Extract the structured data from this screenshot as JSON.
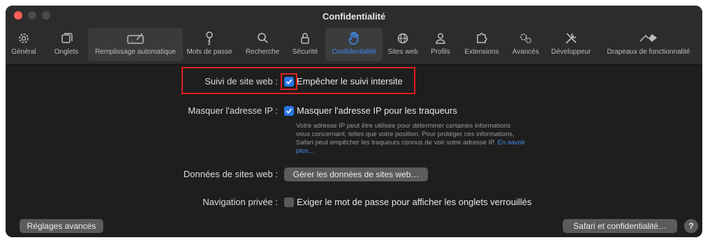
{
  "window": {
    "title": "Confidentialité"
  },
  "toolbar": {
    "tabs": [
      {
        "label": "Général",
        "icon": "gear-icon"
      },
      {
        "label": "Onglets",
        "icon": "tabs-icon"
      },
      {
        "label": "Remplissage automatique",
        "icon": "autofill-icon"
      },
      {
        "label": "Mots de passe",
        "icon": "key-icon"
      },
      {
        "label": "Recherche",
        "icon": "search-icon"
      },
      {
        "label": "Sécurité",
        "icon": "lock-icon"
      },
      {
        "label": "Confidentialité",
        "icon": "hand-icon"
      },
      {
        "label": "Sites web",
        "icon": "globe-icon"
      },
      {
        "label": "Profils",
        "icon": "person-icon"
      },
      {
        "label": "Extensions",
        "icon": "puzzle-icon"
      },
      {
        "label": "Avancés",
        "icon": "gears-icon"
      },
      {
        "label": "Développeur",
        "icon": "tools-icon"
      },
      {
        "label": "Drapeaux de fonctionnalité",
        "icon": "flags-icon"
      }
    ]
  },
  "settings": {
    "tracking": {
      "label": "Suivi de site web :",
      "option": "Empêcher le suivi intersite",
      "checked": true
    },
    "hide_ip": {
      "label": "Masquer l'adresse IP :",
      "option": "Masquer l'adresse IP pour les traqueurs",
      "checked": true,
      "description": "Votre adresse IP peut être utilisée pour déterminer certaines informations vous concernant, telles que votre position. Pour protéger ces informations, Safari peut empêcher les traqueurs connus de voir votre adresse IP.",
      "link": "En savoir plus…"
    },
    "website_data": {
      "label": "Données de sites web :",
      "button": "Gérer les données de sites web…"
    },
    "private_browsing": {
      "label": "Navigation privée :",
      "option": "Exiger le mot de passe pour afficher les onglets verrouillés",
      "checked": false
    }
  },
  "footer": {
    "advanced_button": "Réglages avancés",
    "safari_privacy_button": "Safari et confidentialité…",
    "help_button": "?"
  },
  "colors": {
    "accent": "#2b75e6",
    "highlight": "#e02020"
  }
}
